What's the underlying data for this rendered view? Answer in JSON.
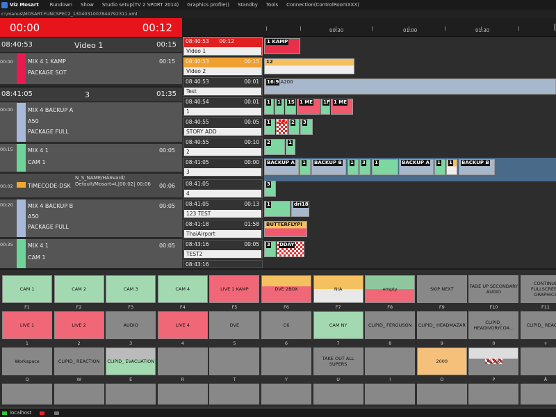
{
  "app": {
    "title": "Viz Mosart"
  },
  "menu": [
    "Rundown",
    "Show",
    "Studio setup(TV 2 SPORT 2014)",
    "Graphics profile()",
    "Standby",
    "Tools",
    "Connection(ControlRoomXXX)"
  ],
  "path": "c:\\manus\\MOSART.FUNCSPEC2_1304031007844792311.xml",
  "timer": {
    "left": "00:00",
    "right": "00:12"
  },
  "rundown": {
    "story1": {
      "tc": "08:40:53",
      "title": "Video 1",
      "dur": "00:15"
    },
    "r1": {
      "tc": "00:00",
      "title": "MIX 4 1 KAMP",
      "dur": "00:15",
      "sub": "PACKAGE SOT"
    },
    "story2": {
      "tc": "08:41:05",
      "title": "3",
      "dur": "01:35"
    },
    "r2": {
      "tc": "00:00",
      "title": "MIX 4 BACKUP A",
      "dur": "",
      "sub1": "A50",
      "sub2": "PACKAGE FULL"
    },
    "r3": {
      "tc": "00:15",
      "title": "MIX 4 1",
      "dur": "00:05",
      "sub": "CAM 1"
    },
    "r4": {
      "tc": "00:02",
      "title": "TIMECODE-DSK",
      "dur": "00:06",
      "note": "N_S_NAME/HÃ¥vard/ Default/Mosart=L|00:02| 00:06"
    },
    "r5": {
      "tc": "00:20",
      "title": "MIX 4 BACKUP B",
      "dur": "00:05",
      "sub1": "A50",
      "sub2": "PACKAGE FULL"
    },
    "r6": {
      "tc": "00:35",
      "title": "MIX 4 1",
      "dur": "00:05",
      "sub": "CAM 1"
    }
  },
  "ruler": {
    "labels": [
      "00:30",
      "01:00",
      "01:30"
    ]
  },
  "timeline": [
    {
      "tc": "08:40:53",
      "dur": "00:12",
      "name": "Video 1"
    },
    {
      "tc": "08:40:53",
      "dur": "00:15",
      "name": "Video 2"
    },
    {
      "tc": "08:40:53",
      "dur": "00:01",
      "name": "Test"
    },
    {
      "tc": "08:40:54",
      "dur": "00:01",
      "name": "1"
    },
    {
      "tc": "08:40:55",
      "dur": "00:05",
      "name": "STORY ADD"
    },
    {
      "tc": "08:40:55",
      "dur": "00:10",
      "name": "2"
    },
    {
      "tc": "08:41:05",
      "dur": "00:00",
      "name": "3"
    },
    {
      "tc": "08:41:05",
      "dur": "",
      "name": "4"
    },
    {
      "tc": "08:41:05",
      "dur": "00:13",
      "name": "123 TEST"
    },
    {
      "tc": "08:41:18",
      "dur": "01:58",
      "name": "ThaiAirport"
    },
    {
      "tc": "08:43:16",
      "dur": "00:05",
      "name": "TEST2"
    }
  ],
  "blocks": {
    "b0": "1 KAMP",
    "b1": "12",
    "b2a": "16:9",
    "b2b": "A200",
    "b3a": "1",
    "b3b": "1",
    "b3c": "1S",
    "b3d": "1 ME",
    "b3e": "1F",
    "b3f": "1 ME",
    "b4a": "1",
    "b4b": "2BX",
    "b4c": "2",
    "b4d": "3",
    "b5a": "2",
    "b5b": "1",
    "b6a": "BACKUP A",
    "b6b": "1",
    "b6c": "BACKUP B",
    "b6d": "1",
    "b6e": "3",
    "b6f": "1",
    "b6g": "BACKUP A",
    "b6h": "1",
    "b6i": "1",
    "b6j": "BACKUP B",
    "b7a": "3",
    "b8a": "1",
    "b8b": "dri18",
    "b9a": "BUTTERFLYPI",
    "b10a": "3",
    "b10b": "DDAY",
    "b11a": "08:43:16"
  },
  "buttons": {
    "row1": [
      "CAM 1",
      "CAM 2",
      "CAM 3",
      "CAM 4",
      "LIVE 1 KAMP",
      "DVE 2BOX",
      "N/A",
      "empty",
      "SKIP NEXT",
      "FADE UP SECONDARY AUDIO",
      "CONTINUE FULLSCREEN GRAPHICS"
    ],
    "keys1": [
      "F1",
      "F2",
      "F3",
      "F4",
      "F5",
      "F6",
      "F7",
      "F8",
      "F9",
      "F10",
      "F11"
    ],
    "row2": [
      "LIVE 1",
      "LIVE 2",
      "AUDIO",
      "LIVE 4",
      "DVE",
      "C6",
      "CAM NY",
      "CLIPID_ FERGUSON",
      "CLIPID_ HEADMAZAR",
      "CLIPID_ HEADIVORYCOA...",
      "CLIPID_ REACTIO"
    ],
    "keys2": [
      "1",
      "2",
      "3",
      "4",
      "5",
      "6",
      "7",
      "8",
      "9",
      "0",
      "+"
    ],
    "row3": [
      "Workspace",
      "CLIPID_ REACTION",
      "CLIPID_ EVACUATION",
      "",
      "",
      "",
      "TAKE OUT ALL SUPERS",
      "",
      "2000",
      "A1500",
      ""
    ],
    "keys3": [
      "Q",
      "W",
      "E",
      "R",
      "T",
      "Y",
      "U",
      "I",
      "O",
      "P",
      "Å"
    ]
  },
  "status": {
    "host": "localhost"
  },
  "colors": {
    "accent_red": "#e02020",
    "green": "#7ed6a0",
    "pink": "#f05a6e",
    "blue": "#a8b8cc",
    "yellow": "#f4c060"
  }
}
